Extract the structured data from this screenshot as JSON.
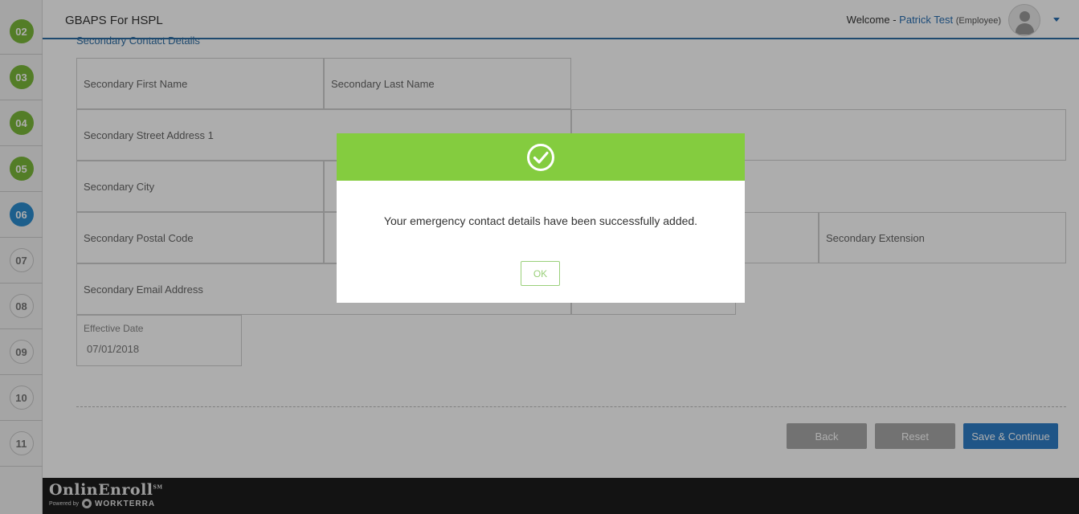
{
  "steps": [
    {
      "label": "02",
      "status": "done"
    },
    {
      "label": "03",
      "status": "done"
    },
    {
      "label": "04",
      "status": "done"
    },
    {
      "label": "05",
      "status": "done"
    },
    {
      "label": "06",
      "status": "current"
    },
    {
      "label": "07",
      "status": "todo"
    },
    {
      "label": "08",
      "status": "todo"
    },
    {
      "label": "09",
      "status": "todo"
    },
    {
      "label": "10",
      "status": "todo"
    },
    {
      "label": "11",
      "status": "todo"
    }
  ],
  "header": {
    "app_title": "GBAPS For HSPL",
    "welcome_prefix": "Welcome -",
    "user_name": "Patrick Test",
    "user_role": "(Employee)",
    "avatar_icon": "user-avatar-icon",
    "menu_icon": "chevron-down-icon"
  },
  "form": {
    "section_title": "Secondary Contact Details",
    "fields": {
      "first_name": "Secondary First Name",
      "last_name": "Secondary Last Name",
      "street1": "Secondary Street Address 1",
      "city": "Secondary City",
      "postal_code": "Secondary Postal Code",
      "extension": "Secondary Extension",
      "email": "Secondary Email Address"
    },
    "effective_date": {
      "label": "Effective Date",
      "value": "07/01/2018"
    }
  },
  "buttons": {
    "back": "Back",
    "reset": "Reset",
    "save_continue": "Save & Continue"
  },
  "footer": {
    "logo_text": "OnlinEnroll",
    "logo_mark": "SM",
    "powered_by": "Powered by",
    "powered_brand": "WORKTERRA"
  },
  "modal": {
    "icon": "check-circle-icon",
    "message": "Your emergency contact details have been successfully added.",
    "ok_label": "OK"
  },
  "colors": {
    "success_green": "#84cc3f",
    "step_done": "#7bb83a",
    "step_current": "#2b8ccf",
    "primary_blue": "#2e7ec8"
  }
}
